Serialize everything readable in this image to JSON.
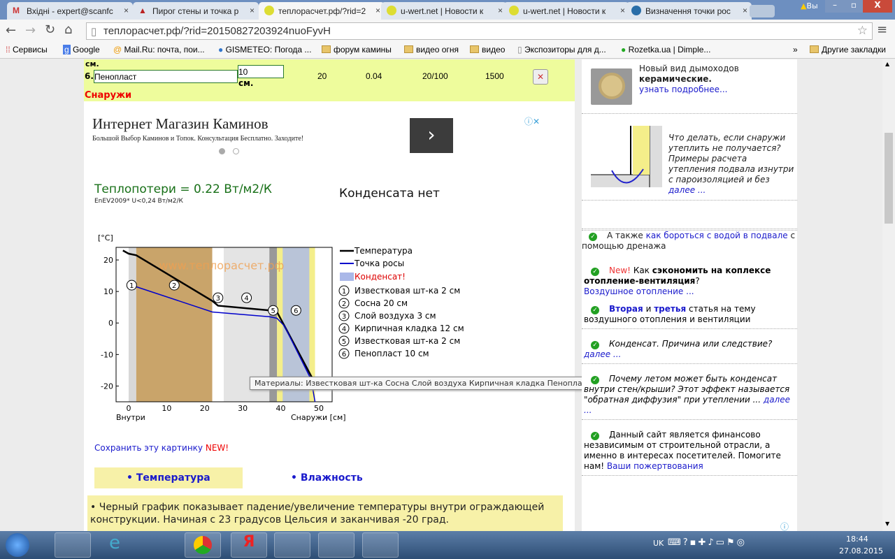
{
  "browser": {
    "tabs": [
      {
        "title": "Вхідні - expert@scanfc",
        "icon": "gmail-icon"
      },
      {
        "title": "Пирог стены и точка р",
        "icon": "site-icon"
      },
      {
        "title": "теплорасчет.рф/?rid=2",
        "icon": "teplo-icon",
        "active": true
      },
      {
        "title": "u-wert.net | Новости к",
        "icon": "uwert-icon"
      },
      {
        "title": "u-wert.net | Новости к",
        "icon": "uwert-icon"
      },
      {
        "title": "Визначення точки рос",
        "icon": "wordpress-icon"
      }
    ],
    "user_badge": "Вы",
    "url": "теплорасчет.рф/?rid=20150827203924nuoFyvH",
    "bookmarks": [
      "Сервисы",
      "Google",
      "Mail.Ru: почта, пои...",
      "GISMETEO: Погода ...",
      "форум камины",
      "видео огня",
      "видео",
      "Экспозиторы для д...",
      "Rozetka.ua | Dimple..."
    ],
    "bookmarks_more": "»",
    "other_bookmarks": "Другие закладки"
  },
  "layer_row": {
    "num": "6.",
    "material": "Пенопласт",
    "thickness": "10",
    "unit": "см.",
    "unit_top": "см.",
    "density": "20",
    "lambda": "0.04",
    "mu": "20/100",
    "c": "1500"
  },
  "outside_label": "Снаружи",
  "ad": {
    "title": "Интернет Магазин Каминов",
    "text": "Большой Выбор Каминов и Топок. Консультация Бесплатно. Заходите!"
  },
  "heat_loss": "Теплопотери = 0.22 Вт/м2/К",
  "norm": "EnEV2009* U<0,24 Вт/м2/К",
  "condensate": "Конденсата нет",
  "chart_data": {
    "type": "line",
    "ylabel": "[°C]",
    "xlabel_left": "Внутри",
    "xlabel_right": "Снаружи [см]",
    "watermark": "www.теплорасчет.рф",
    "xlim": [
      -3.3,
      53.5
    ],
    "ylim": [
      -25,
      24
    ],
    "xticks": [
      "0",
      "10",
      "20",
      "30",
      "40",
      "50"
    ],
    "yticks": [
      "20",
      "10",
      "0",
      "-10",
      "-20"
    ],
    "layers": [
      {
        "n": "1",
        "from": 0,
        "to": 2,
        "color": "#d8d8d8"
      },
      {
        "n": "2",
        "from": 2,
        "to": 22,
        "color": "#c9a46a"
      },
      {
        "n": "3",
        "from": 22,
        "to": 25,
        "color": "#ffffff"
      },
      {
        "n": "4",
        "from": 25,
        "to": 37,
        "color": "#e4e4e4"
      },
      {
        "n": "5",
        "from": 37,
        "to": 39,
        "color": "#999999"
      },
      {
        "n": "6",
        "from": 39,
        "to": 49,
        "color": "#b9c4d8"
      }
    ],
    "series": [
      {
        "name": "Температура",
        "color": "#000000",
        "x": [
          -1.5,
          0,
          2,
          22,
          23.5,
          37,
          39,
          41,
          48.5
        ],
        "y": [
          23,
          22,
          21.5,
          7,
          5.5,
          4,
          3.5,
          -1,
          -18
        ]
      },
      {
        "name": "Точка росы",
        "color": "#0000cc",
        "x": [
          2,
          22,
          37,
          39,
          41,
          48,
          49
        ],
        "y": [
          11.5,
          3.5,
          2,
          1.5,
          -1,
          -18,
          -25
        ]
      }
    ],
    "legend": [
      "Температура",
      "Точка росы",
      "Конденсат!"
    ],
    "layer_legend": [
      "Известковая шт-ка 2 см",
      "Сосна 20 см",
      "Слой воздуха 3 см",
      "Кирпичная кладка 12 см",
      "Известковая шт-ка 2 см",
      "Пенопласт 10 см"
    ]
  },
  "tooltip": "Материалы: Известковая шт-ка Сосна Слой воздуха Кирпичная кладка Пенопласт",
  "save": {
    "link": "Сохранить эту картинку",
    "new": "NEW!"
  },
  "tabs2": [
    "Температура",
    "Влажность"
  ],
  "info": "Черный график показывает падение/увеличение температуры внутри ограждающей конструкции. Начиная с 23 градусов Цельсия и заканчивая -20 град.",
  "sidebar": {
    "chimney": {
      "t1": "Новый вид дымоходов",
      "t2": "керамические.",
      "link": "узнать подробнее..."
    },
    "basement": {
      "text": "Что делать, если снаружи утеплить не получается? Примеры расчета утепления подвала изнутри с пароизоляцией и без",
      "link": "далее ..."
    },
    "i1": {
      "a": "А также",
      "link": "как бороться с водой в подвале",
      "b": "с помощью дренажа"
    },
    "i2": {
      "new": "New!",
      "a": "Как",
      "bold": "сэкономить на коплексе отопление-вентиляция",
      "q": "?",
      "link": "Воздушное отопление ..."
    },
    "i3": {
      "l1": "Вторая",
      "and": "и",
      "l2": "третья",
      "rest": "статья на тему воздушного отопления и вентиляции"
    },
    "i4": {
      "text": "Конденсат. Причина или следствие?",
      "link": "далее ..."
    },
    "i5": {
      "text": "Почему летом может быть конденсат внутри стен/крыши? Этот эффект называется \"обратная диффузия\" при утеплении ...",
      "link": "далее ..."
    },
    "i6": {
      "text": "Данный сайт является финансово независимым от строительной отрасли, а именно в интересах посетителей. Помогите нам!",
      "link": "Ваши пожертвования"
    }
  },
  "taskbar": {
    "lang": "UK",
    "time": "18:44",
    "date": "27.08.2015"
  }
}
